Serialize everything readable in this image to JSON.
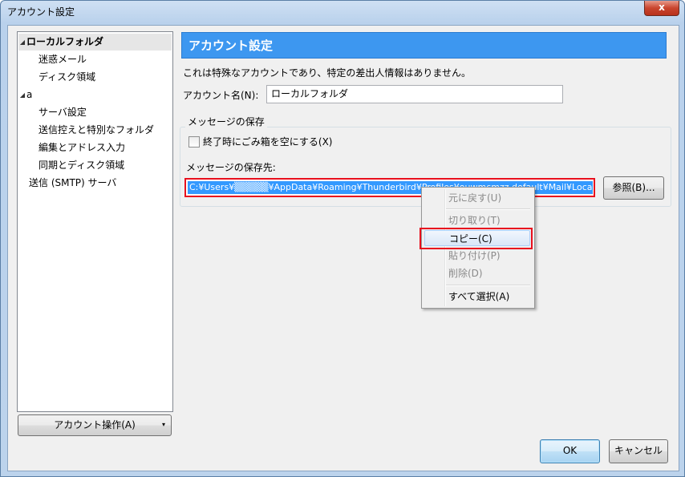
{
  "window": {
    "title": "アカウント設定",
    "close_label": "x"
  },
  "tree": {
    "items": [
      {
        "label": "ローカルフォルダ",
        "arrow": "◢",
        "selected": true
      },
      {
        "label": "迷惑メール"
      },
      {
        "label": "ディスク領域"
      },
      {
        "label": "a",
        "arrow": "◢"
      },
      {
        "label": "サーバ設定"
      },
      {
        "label": "送信控えと特別なフォルダ"
      },
      {
        "label": "編集とアドレス入力"
      },
      {
        "label": "同期とディスク領域"
      },
      {
        "label": "送信 (SMTP) サーバ"
      }
    ]
  },
  "account_actions": {
    "label": "アカウント操作(A)",
    "dropdown_glyph": "▾"
  },
  "main": {
    "header": "アカウント設定",
    "notice": "これは特殊なアカウントであり、特定の差出人情報はありません。",
    "account_name_label": "アカウント名(N):",
    "account_name_value": "ローカルフォルダ",
    "storage_group_title": "メッセージの保存",
    "empty_trash_label": "終了時にごみ箱を空にする(X)",
    "path_label": "メッセージの保存先:",
    "path_value": "C:¥Users¥▒▒▒▒▒¥AppData¥Roaming¥Thunderbird¥Profiles¥ouwmcmzz.default¥Mail¥Local Folders",
    "browse_label": "参照(B)..."
  },
  "context_menu": {
    "items": [
      {
        "label": "元に戻す(U)",
        "disabled": true
      },
      {
        "label": "切り取り(T)",
        "disabled": true
      },
      {
        "label": "コピー(C)",
        "disabled": false,
        "hover": true
      },
      {
        "label": "貼り付け(P)",
        "disabled": true
      },
      {
        "label": "削除(D)",
        "disabled": true
      },
      {
        "label": "すべて選択(A)",
        "disabled": false
      }
    ]
  },
  "footer": {
    "ok_label": "OK",
    "cancel_label": "キャンセル"
  },
  "colors": {
    "header_blue": "#3d97f0",
    "selection_blue": "#3399ff",
    "highlight_red": "#e8101e"
  }
}
